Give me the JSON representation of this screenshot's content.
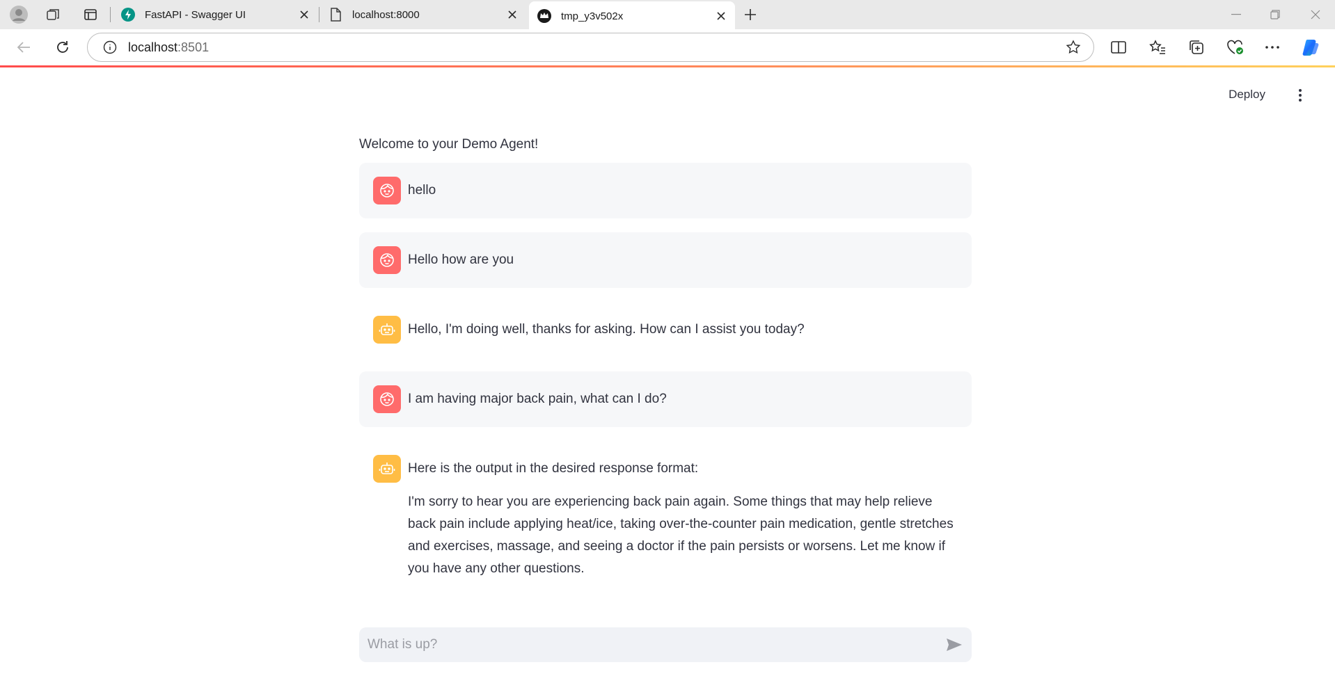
{
  "browser": {
    "tabs": [
      {
        "title": "FastAPI - Swagger UI",
        "icon": "fastapi-icon"
      },
      {
        "title": "localhost:8000",
        "icon": "document-icon"
      },
      {
        "title": "tmp_y3v502x",
        "icon": "streamlit-crown-icon"
      }
    ],
    "url": {
      "host": "localhost",
      "port": ":8501"
    }
  },
  "header": {
    "deploy_label": "Deploy"
  },
  "main": {
    "welcome": "Welcome to your Demo Agent!",
    "messages": [
      {
        "role": "user",
        "text": "hello"
      },
      {
        "role": "user",
        "text": "Hello how are you"
      },
      {
        "role": "assistant",
        "text": "Hello, I'm doing well, thanks for asking. How can I assist you today?"
      },
      {
        "role": "user",
        "text": "I am having major back pain, what can I do?"
      },
      {
        "role": "assistant",
        "text": "Here is the output in the desired response format:",
        "paragraph": "I'm sorry to hear you are experiencing back pain again. Some things that may help relieve back pain include applying heat/ice, taking over-the-counter pain medication, gentle stretches and exercises, massage, and seeing a doctor if the pain persists or worsens. Let me know if you have any other questions."
      }
    ]
  },
  "chat_input": {
    "placeholder": "What is up?"
  },
  "colors": {
    "user_avatar": "#ff6b6b",
    "bot_avatar": "#ffbd45",
    "accent": "#ff4b4b"
  }
}
